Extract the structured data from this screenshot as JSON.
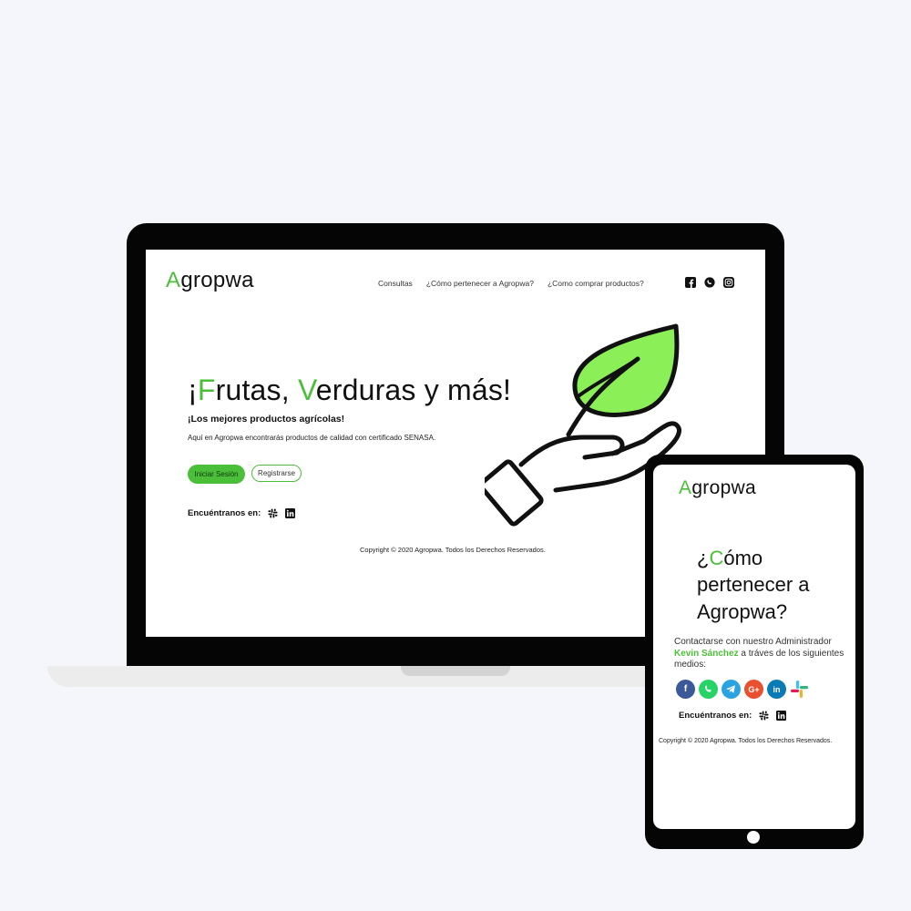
{
  "brand": {
    "logo_accent": "A",
    "logo_rest": "gropwa",
    "accent_color": "#4cbf3a"
  },
  "desktop": {
    "nav": [
      "Consultas",
      "¿Cómo pertenecer a Agropwa?",
      "¿Como comprar productos?"
    ],
    "social_icons": [
      "facebook-icon",
      "whatsapp-icon",
      "instagram-icon"
    ],
    "hero": {
      "title_p1": "¡",
      "title_p2": "F",
      "title_p3": "rutas, ",
      "title_p4": "V",
      "title_p5": "erduras y más!",
      "subtitle": "¡Los mejores productos agrícolas!",
      "description": "Aquí en Agropwa encontrarás productos de calidad con certificado SENASA."
    },
    "buttons": {
      "login": "Iniciar Sesión",
      "register": "Registrarse"
    },
    "find_us": "Encuéntranos en:",
    "copyright": "Copyright © 2020 Agropwa. Todos los Derechos Reservados."
  },
  "tablet": {
    "title_p1": "¿",
    "title_p2": "C",
    "title_p3": "ómo pertenecer a Agropwa?",
    "contact_p1": "Contactarse con nuestro Administrador ",
    "contact_name": "Kevin Sánchez",
    "contact_p2": " a tráves de los siguientes medios:",
    "contact_icons": [
      "facebook-icon",
      "whatsapp-icon",
      "telegram-icon",
      "google-plus-icon",
      "linkedin-icon",
      "slack-icon"
    ],
    "find_us": "Encuéntranos en:",
    "copyright": "Copyright © 2020 Agropwa. Todos los Derechos Reservados."
  }
}
